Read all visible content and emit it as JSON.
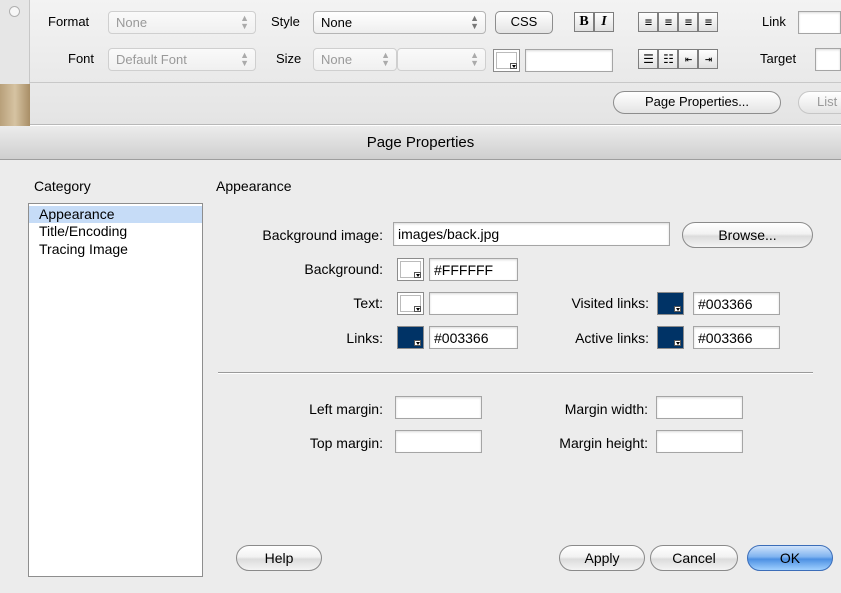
{
  "inspector": {
    "format_label": "Format",
    "format_value": "None",
    "style_label": "Style",
    "style_value": "None",
    "css_button": "CSS",
    "bold_glyph": "B",
    "italic_glyph": "I",
    "link_label": "Link",
    "font_label": "Font",
    "font_value": "Default Font",
    "size_label": "Size",
    "size_value": "None",
    "target_label": "Target",
    "page_properties_button": "Page Properties...",
    "list_item_button": "List"
  },
  "dialog": {
    "title": "Page Properties",
    "category_label": "Category",
    "categories": [
      {
        "label": "Appearance",
        "selected": true
      },
      {
        "label": "Title/Encoding",
        "selected": false
      },
      {
        "label": "Tracing Image",
        "selected": false
      }
    ],
    "section_title": "Appearance",
    "bg_image_label": "Background image:",
    "bg_image_value": "images/back.jpg",
    "browse_button": "Browse...",
    "background_label": "Background:",
    "background_value": "#FFFFFF",
    "text_label": "Text:",
    "text_value": "",
    "visited_label": "Visited links:",
    "visited_value": "#003366",
    "links_label": "Links:",
    "links_value": "#003366",
    "active_label": "Active links:",
    "active_value": "#003366",
    "left_margin_label": "Left margin:",
    "margin_width_label": "Margin width:",
    "top_margin_label": "Top margin:",
    "margin_height_label": "Margin height:",
    "help_button": "Help",
    "apply_button": "Apply",
    "cancel_button": "Cancel",
    "ok_button": "OK"
  },
  "colors": {
    "link_swatch": "#003366",
    "selection": "#c6dcf7",
    "default_button": "#4d90e3"
  }
}
